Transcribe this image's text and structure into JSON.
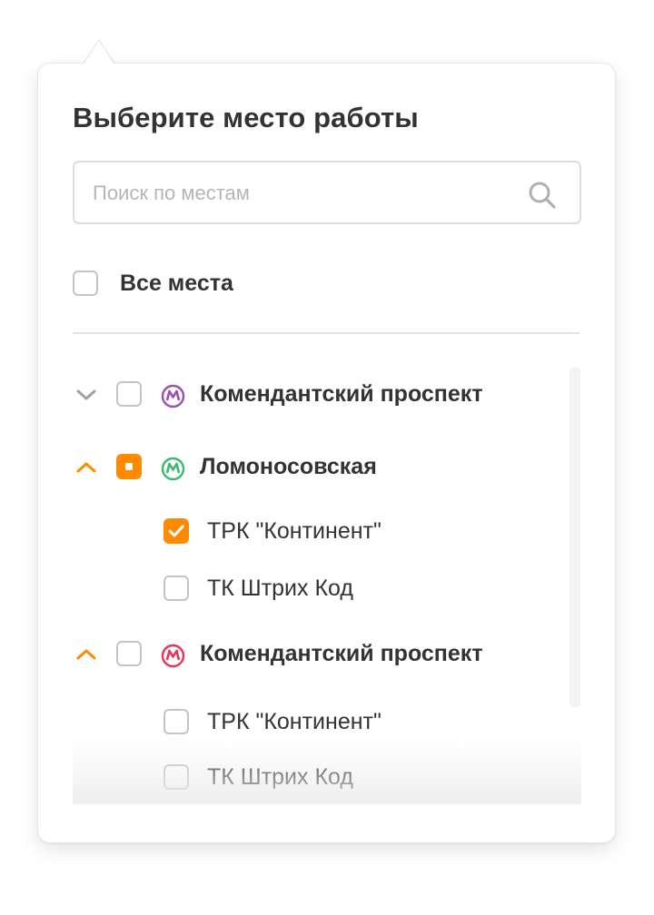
{
  "popup": {
    "title": "Выберите место работы",
    "search": {
      "placeholder": "Поиск по местам",
      "value": ""
    },
    "all_places": {
      "label": "Все места",
      "checked": false
    }
  },
  "colors": {
    "accent": "#ff8a00",
    "metro_purple": "#9b4fb0",
    "metro_green": "#3bb873",
    "metro_red": "#e8345a",
    "chevron_collapsed": "#a0a0a0"
  },
  "groups": [
    {
      "label": "Комендантский проспект",
      "expanded": false,
      "state": "unchecked",
      "metro_icon": "metro-icon",
      "metro_color": "#9b4fb0",
      "items": []
    },
    {
      "label": "Ломоносовская",
      "expanded": true,
      "state": "partial",
      "metro_icon": "metro-icon",
      "metro_color": "#3bb873",
      "items": [
        {
          "label": "ТРК \"Континент\"",
          "checked": true
        },
        {
          "label": "ТК Штрих Код",
          "checked": false
        }
      ]
    },
    {
      "label": "Комендантский проспект",
      "expanded": true,
      "state": "unchecked",
      "metro_icon": "metro-icon",
      "metro_color": "#e8345a",
      "items": [
        {
          "label": "ТРК \"Континент\"",
          "checked": false
        },
        {
          "label": "ТК Штрих Код",
          "checked": false
        }
      ]
    }
  ]
}
